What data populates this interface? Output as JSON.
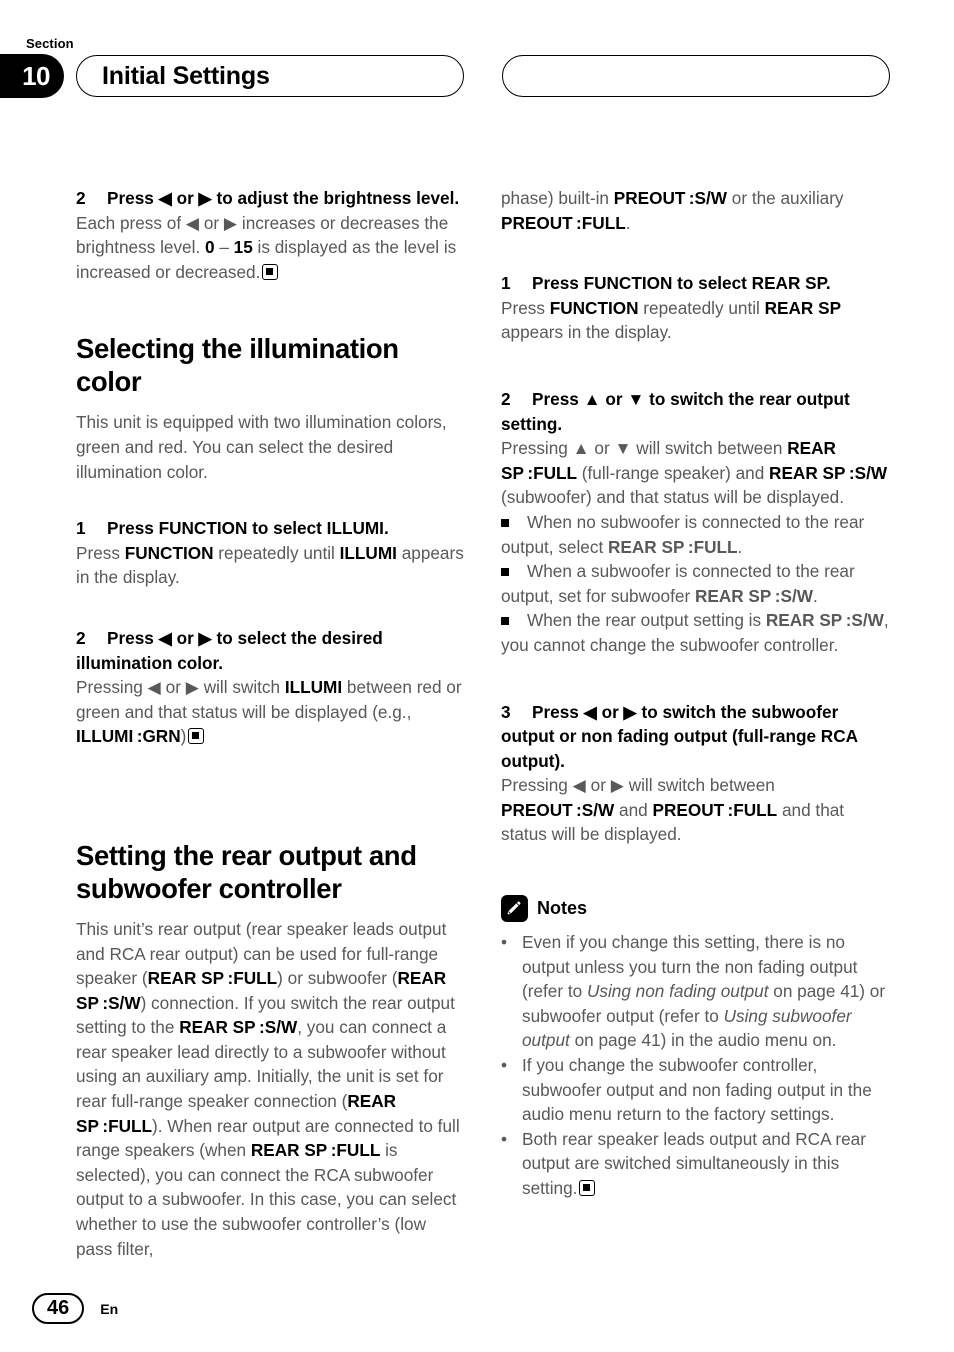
{
  "header": {
    "section_label": "Section",
    "section_number": "10",
    "title": "Initial Settings",
    "right_pill_title": ""
  },
  "left_column": {
    "step_brightness": {
      "number": "2",
      "head": "Press ◀ or ▶ to adjust the brightness level.",
      "body_html": "Each press of ◀ or ▶ increases or decreases the brightness level. <b>0</b> – <b>15</b> is displayed as the level is increased or decreased."
    },
    "illumination": {
      "title": "Selecting the illumination color",
      "intro": "This unit is equipped with two illumination colors, green and red. You can select the desired illumination color.",
      "step1": {
        "number": "1",
        "head": "Press FUNCTION to select ILLUMI.",
        "body_html": "Press <b>FUNCTION</b> repeatedly until <b>ILLUMI</b> appears in the display."
      },
      "step2": {
        "number": "2",
        "head": "Press ◀ or ▶ to select the desired illumination color.",
        "body_html": "Pressing ◀ or ▶ will switch <b>ILLUMI</b> between red or green and that status will be displayed (e.g., <b>ILLUMI :GRN</b>)"
      }
    },
    "rear_output": {
      "title": "Setting the rear output and subwoofer controller",
      "intro_html": "This unit’s rear output (rear speaker leads output and RCA rear output) can be used for full-range speaker (<b>REAR SP :FULL</b>) or subwoofer (<b>REAR SP :S/W</b>) connection. If you switch the rear output setting to the <b>REAR SP :S/W</b>, you can connect a rear speaker lead directly to a subwoofer without using an auxiliary amp. Initially, the unit is set for rear full-range speaker connection (<b>REAR SP :FULL</b>). When rear output are connected to full range speakers (when <b>REAR SP :FULL</b> is selected), you can connect the RCA subwoofer output to a subwoofer. In this case, you can select whether to use the subwoofer controller’s (low pass filter,"
    }
  },
  "right_column": {
    "intro_continued_html": "phase) built-in <b>PREOUT :S/W</b> or the auxiliary <b>PREOUT :FULL</b>.",
    "step1": {
      "number": "1",
      "head": "Press FUNCTION to select REAR SP.",
      "body_html": "Press <b>FUNCTION</b> repeatedly until <b>REAR SP</b> appears in the display."
    },
    "step2": {
      "number": "2",
      "head": "Press ▲ or ▼ to switch the rear output setting.",
      "body_html": "Pressing ▲ or ▼ will switch between <b>REAR SP :FULL</b> (full-range speaker) and <b>REAR SP :S/W</b> (subwoofer) and that status will be displayed.",
      "bullets": [
        "When no subwoofer is connected to the rear output, select <b>REAR SP :FULL</b>.",
        "When a subwoofer is connected to the rear output, set for subwoofer <b>REAR SP :S/W</b>.",
        "When the rear output setting is <b>REAR SP :S/W</b>, you cannot change the subwoofer controller."
      ]
    },
    "step3": {
      "number": "3",
      "head": "Press ◀ or ▶ to switch the subwoofer output or non fading output (full-range RCA output).",
      "body_html": "Pressing ◀ or ▶ will switch between <b>PREOUT :S/W</b> and <b>PREOUT :FULL</b> and that status will be displayed."
    },
    "notes": {
      "title": "Notes",
      "icon": "pencil-icon",
      "items": [
        "Even if you change this setting, there is no output unless you turn the non fading output (refer to <i>Using non fading output</i> on page 41) or subwoofer output (refer to <i>Using subwoofer output</i> on page 41) in the audio menu on.",
        "If you change the subwoofer controller, subwoofer output and non fading output in the audio menu return to the factory settings.",
        "Both rear speaker leads output and RCA rear output are switched simultaneously in this setting."
      ],
      "bullet_glyph": "•"
    }
  },
  "footer": {
    "page_number": "46",
    "language": "En"
  },
  "colors": {
    "body_text": "#595959",
    "heading": "#000000",
    "accent": "#000000"
  }
}
